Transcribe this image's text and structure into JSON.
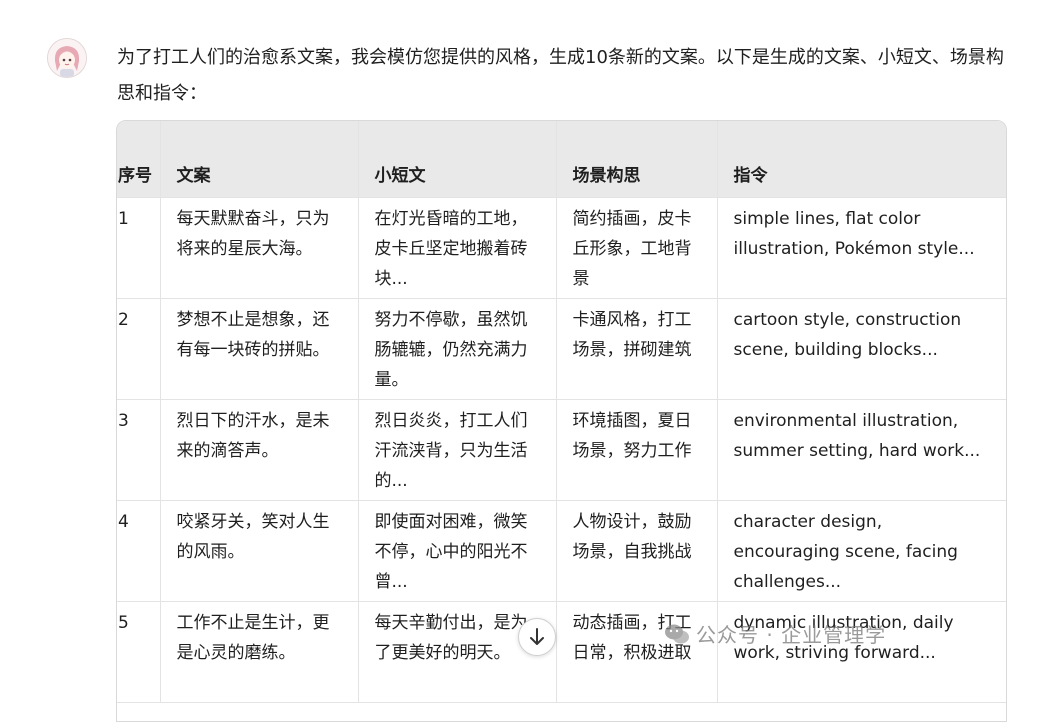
{
  "intro_text": "为了打工人们的治愈系文案，我会模仿您提供的风格，生成10条新的文案。以下是生成的文案、小短文、场景构思和指令：",
  "table": {
    "headers": [
      "序号",
      "文案",
      "小短文",
      "场景构思",
      "指令"
    ],
    "rows": [
      [
        "1",
        "每天默默奋斗，只为将来的星辰大海。",
        "在灯光昏暗的工地，皮卡丘坚定地搬着砖块...",
        "简约插画，皮卡丘形象，工地背景",
        "simple lines, flat color illustration, Pokémon style..."
      ],
      [
        "2",
        "梦想不止是想象，还有每一块砖的拼贴。",
        "努力不停歇，虽然饥肠辘辘，仍然充满力量。",
        "卡通风格，打工场景，拼砌建筑",
        "cartoon style, construction scene, building blocks..."
      ],
      [
        "3",
        "烈日下的汗水，是未来的滴答声。",
        "烈日炎炎，打工人们汗流浃背，只为生活的...",
        "环境插图，夏日场景，努力工作",
        "environmental illustration, summer setting, hard work..."
      ],
      [
        "4",
        "咬紧牙关，笑对人生的风雨。",
        "即使面对困难，微笑不停，心中的阳光不曾...",
        "人物设计，鼓励场景，自我挑战",
        "character design, encouraging scene, facing challenges..."
      ],
      [
        "5",
        "工作不止是生计，更是心灵的磨练。",
        "每天辛勤付出，是为了更美好的明天。",
        "动态插画，打工日常，积极进取",
        "dynamic illustration, daily work, striving forward..."
      ]
    ]
  },
  "watermark_text": "公众号 · 企业管理学",
  "icons": {
    "avatar": "anime-girl-avatar",
    "scroll": "arrow-down-icon",
    "watermark": "wechat-icon"
  },
  "colors": {
    "header_bg": "#e9e9e9",
    "border": "#e3e3e3",
    "text": "#1f1f1f"
  }
}
